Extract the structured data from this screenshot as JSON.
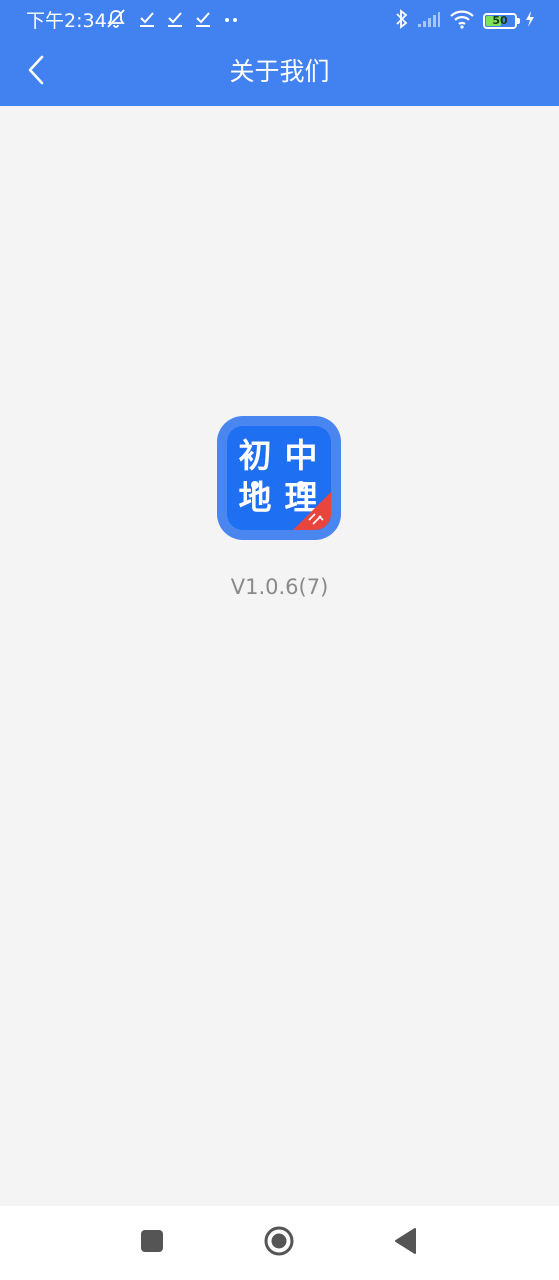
{
  "status_bar": {
    "time": "下午2:34",
    "battery_level": "50",
    "icons": [
      "mute-icon",
      "check-icon",
      "check-icon",
      "check-icon",
      "more-dots-icon",
      "bluetooth-icon",
      "signal-icon",
      "wifi-icon",
      "battery-icon",
      "charging-icon"
    ]
  },
  "app_bar": {
    "title": "关于我们",
    "back_icon": "chevron-left-icon"
  },
  "app_logo": {
    "chars": [
      "初",
      "中",
      "地",
      "理"
    ]
  },
  "version": "V1.0.6(7)",
  "nav_bar": {
    "icons": [
      "recents-square-icon",
      "home-circle-icon",
      "back-triangle-icon"
    ]
  },
  "colors": {
    "primary": "#4282f0",
    "logo_blue": "#1f6ff2",
    "logo_ribbon": "#e8453c",
    "page_background": "#f4f4f4",
    "version_text": "#8a8a8a"
  }
}
